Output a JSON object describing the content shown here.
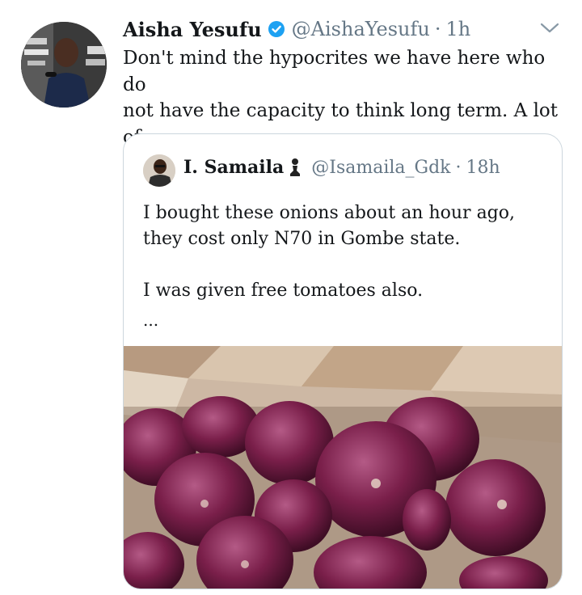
{
  "tweet": {
    "author_name": "Aisha Yesufu",
    "author_handle": "@AishaYesufu",
    "separator": "·",
    "time": "1h",
    "text": "Don't mind the hypocrites we have here who do\nnot have the capacity to think long term. A lot of\nfarmers and traders are going to lose money."
  },
  "quoted_tweet": {
    "author_name": "I. Samaila",
    "author_handle": "@Isamaila_Gdk",
    "separator": "·",
    "time": "18h",
    "text": "I bought these onions about an hour ago,\nthey cost only N70 in Gombe state.\n\nI was given free tomatoes also.",
    "ellipsis": "..."
  },
  "icons": {
    "verified": "verified-badge-icon",
    "more": "chevron-down-icon",
    "pawn": "chess-pawn-icon"
  },
  "colors": {
    "text": "#14171a",
    "secondary": "#657786",
    "verified_blue": "#1da1f2",
    "border": "#ccd6dd",
    "onion": "#7a1f4a"
  }
}
